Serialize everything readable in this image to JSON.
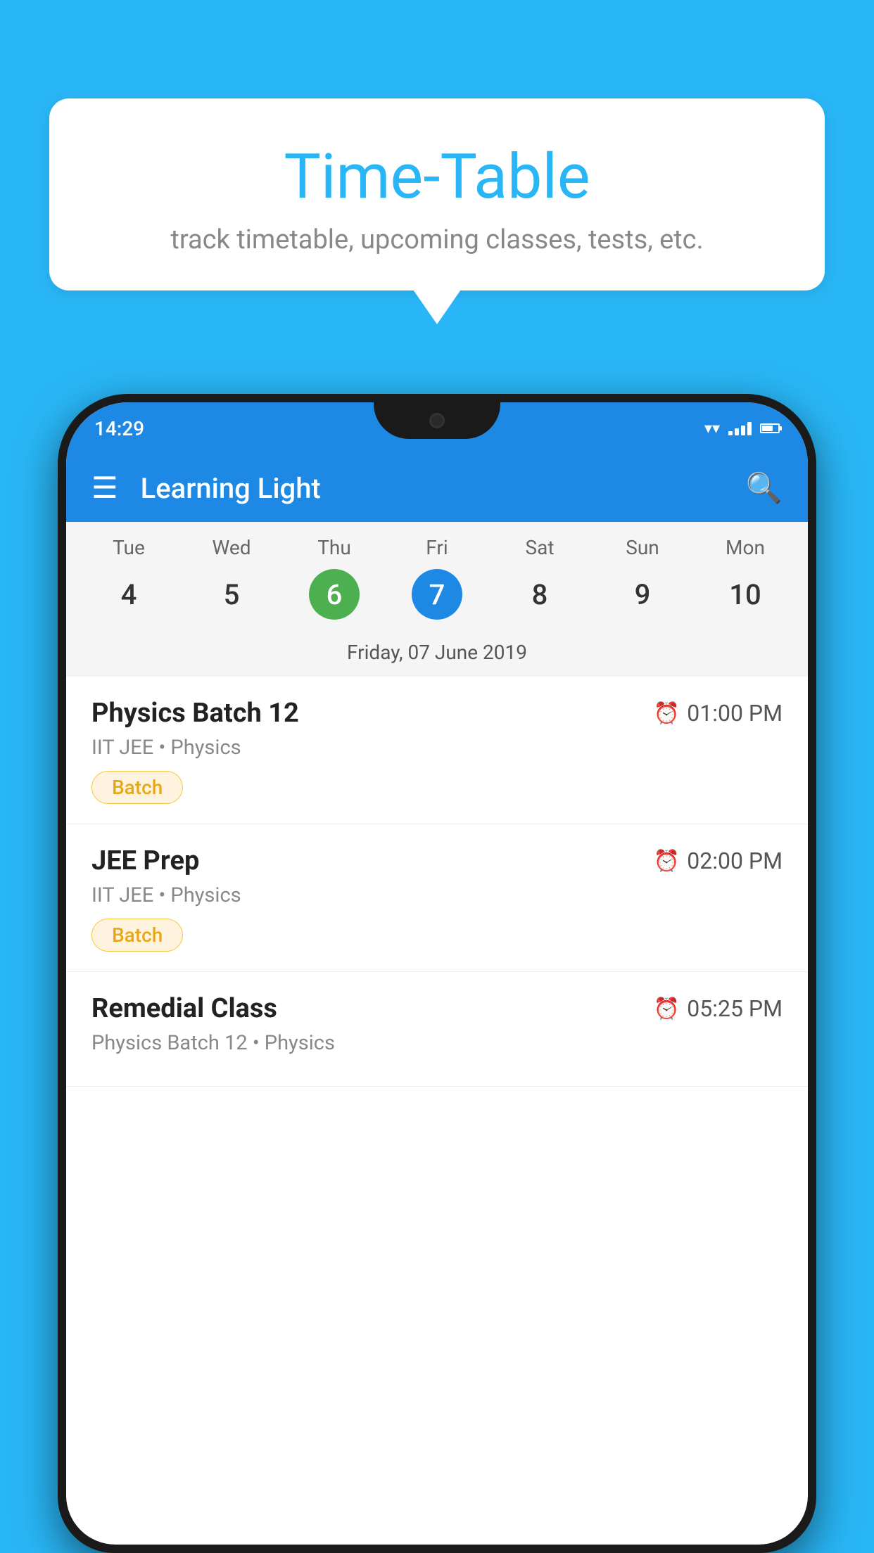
{
  "background_color": "#29B6F6",
  "speech_bubble": {
    "title": "Time-Table",
    "subtitle": "track timetable, upcoming classes, tests, etc."
  },
  "phone": {
    "status_bar": {
      "time": "14:29"
    },
    "app_bar": {
      "title": "Learning Light"
    },
    "calendar": {
      "days": [
        {
          "name": "Tue",
          "num": "4",
          "state": "normal"
        },
        {
          "name": "Wed",
          "num": "5",
          "state": "normal"
        },
        {
          "name": "Thu",
          "num": "6",
          "state": "today"
        },
        {
          "name": "Fri",
          "num": "7",
          "state": "selected"
        },
        {
          "name": "Sat",
          "num": "8",
          "state": "normal"
        },
        {
          "name": "Sun",
          "num": "9",
          "state": "normal"
        },
        {
          "name": "Mon",
          "num": "10",
          "state": "normal"
        }
      ],
      "selected_date_label": "Friday, 07 June 2019"
    },
    "schedule": [
      {
        "title": "Physics Batch 12",
        "time": "01:00 PM",
        "subtitle": "IIT JEE • Physics",
        "badge": "Batch"
      },
      {
        "title": "JEE Prep",
        "time": "02:00 PM",
        "subtitle": "IIT JEE • Physics",
        "badge": "Batch"
      },
      {
        "title": "Remedial Class",
        "time": "05:25 PM",
        "subtitle": "Physics Batch 12 • Physics",
        "badge": null
      }
    ]
  }
}
